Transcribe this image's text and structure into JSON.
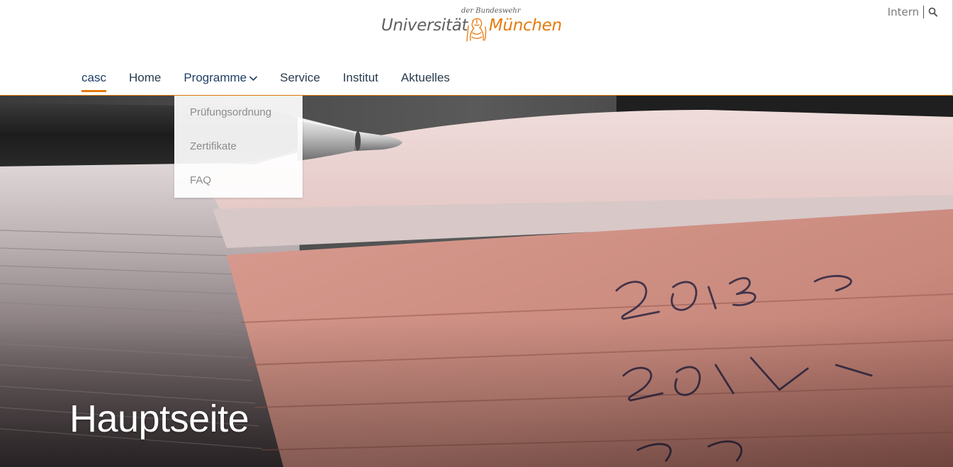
{
  "logo": {
    "sub": "der Bundeswehr",
    "left": "Universität",
    "right": "München"
  },
  "top_links": {
    "intern": "Intern",
    "search_icon": "search-icon"
  },
  "nav": {
    "items": [
      {
        "label": "casc",
        "active": true
      },
      {
        "label": "Home"
      },
      {
        "label": "Programme",
        "has_dropdown": true,
        "open": true
      },
      {
        "label": "Service"
      },
      {
        "label": "Institut"
      },
      {
        "label": "Aktuelles"
      }
    ]
  },
  "dropdown": {
    "items": [
      "Prüfungsordnung",
      "Zertifikate",
      "FAQ"
    ]
  },
  "hero": {
    "title": "Hauptseite"
  },
  "colors": {
    "accent": "#e57a0b",
    "nav_text": "#2a3b4c",
    "active_text": "#1f3f66"
  }
}
